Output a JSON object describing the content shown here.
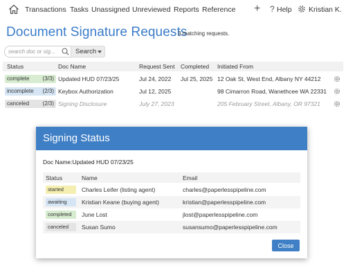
{
  "nav": {
    "items": [
      "Transactions",
      "Tasks",
      "Unassigned",
      "Unreviewed",
      "Reports",
      "Reference"
    ],
    "help": "Help",
    "user": "Kristian K."
  },
  "page": {
    "title": "Document Signature Requests",
    "match_count": "3 matching requests."
  },
  "search": {
    "placeholder": "search doc or sig...",
    "button": "Search"
  },
  "table": {
    "headers": [
      "Status",
      "Doc Name",
      "Request Sent",
      "Completed",
      "Initiated From"
    ],
    "rows": [
      {
        "status": "complete",
        "count": "(3/3)",
        "doc": "Updated HUD 07/23/25",
        "sent": "Jul 24, 2022",
        "completed": "Jul 25, 2025",
        "from": "12 Oak St, West End, Albany NY 44212",
        "pill_color": "#d7ecd0"
      },
      {
        "status": "incomplete",
        "count": "(2/3)",
        "doc": "Keybox Authorization",
        "sent": "Jul 12, 2025",
        "completed": "",
        "from": "98 Cimarron Road, Wanethcee WA 22331",
        "pill_color": "#d5e5f3"
      },
      {
        "status": "canceled",
        "count": "(2/3)",
        "doc": "Signing Disclosure",
        "sent": "July 27, 2023",
        "completed": "",
        "from": "205 February Street, Albany, OR 97321",
        "pill_color": "#e4e4e4"
      }
    ]
  },
  "modal": {
    "title": "Signing Status",
    "doc_label": "Doc Name:",
    "doc_value": "Updated HUD 07/23/25",
    "headers": [
      "Status",
      "Name",
      "Email"
    ],
    "rows": [
      {
        "status": "started",
        "name": "Charles Leifer (listing agent)",
        "email": "charles@paperlesspipeline.com",
        "pill_color": "#f4efb0"
      },
      {
        "status": "awaiting",
        "name": "Kristian Keane (buying agent)",
        "email": "kristian@paperlesspipeline.com",
        "pill_color": "#d5e5f3"
      },
      {
        "status": "completed",
        "name": "June Lost",
        "email": "jlost@paperlesspipeline.com",
        "pill_color": "#d7ecd0"
      },
      {
        "status": "canceled",
        "name": "Susan Sumo",
        "email": "susansumo@paperlesspipeline.com",
        "pill_color": "#e4e4e4"
      }
    ],
    "close": "Close"
  },
  "colors": {
    "accent": "#3a7bc8",
    "modal_header": "#3f7fc5"
  }
}
